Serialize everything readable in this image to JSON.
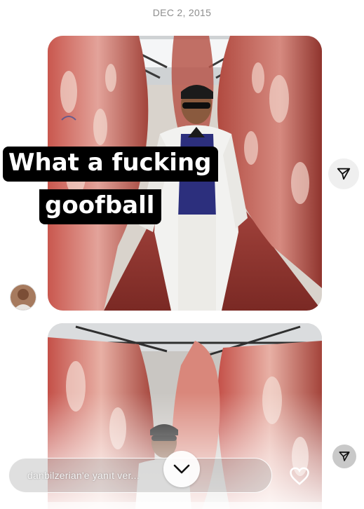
{
  "thread": {
    "date_header": "DEC 2, 2015"
  },
  "story_reply_1": {
    "caption_line_1": "What a fucking",
    "caption_line_2": "goofball"
  },
  "composer": {
    "placeholder": "danbilzerian'e yanıt ver...",
    "icons": [
      "chevron-down-icon",
      "heart-icon",
      "send-icon"
    ]
  },
  "colors": {
    "caption_bg": "#000000",
    "caption_text": "#ffffff",
    "date_text": "#8e8e8e",
    "meat_red": "#9b3b34",
    "coat_white": "#f2f2f0"
  }
}
